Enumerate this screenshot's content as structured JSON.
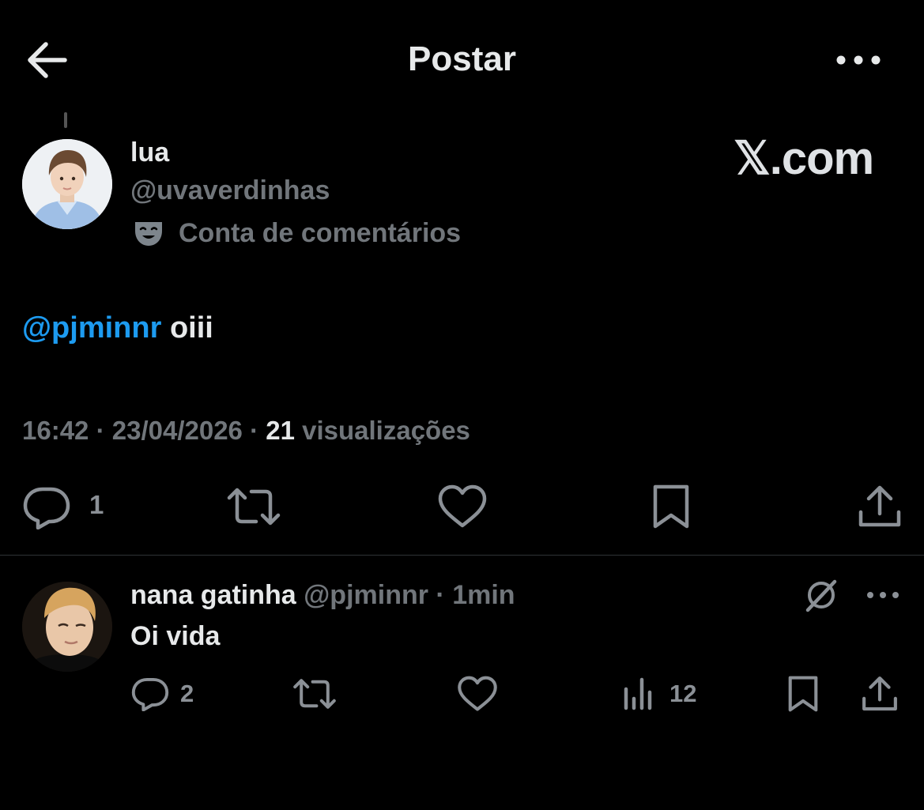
{
  "header": {
    "title": "Postar",
    "back_icon": "arrow-left-icon",
    "more_icon": "more-horizontal-icon"
  },
  "watermark": "𝕏.com",
  "post": {
    "author_name": "lua",
    "author_handle": "@uvaverdinhas",
    "account_label": "Conta de comentários",
    "account_label_icon": "parody-mask-icon",
    "mention": "@pjminnr",
    "text": " oiii",
    "time": "16:42",
    "date": "23/04/2026",
    "separator": " · ",
    "views_count": "21",
    "views_label": " visualizações",
    "reply_count": "1",
    "colors": {
      "mention": "#1d9bf0",
      "muted": "#71767b",
      "text": "#e7e9ea",
      "background": "#000000"
    }
  },
  "reply": {
    "author_name": "nana gatinha",
    "author_handle": "@pjminnr",
    "separator": " · ",
    "time": "1min",
    "text": "Oi vida",
    "reply_count": "2",
    "views_count": "12",
    "grok_icon": "grok-icon"
  }
}
